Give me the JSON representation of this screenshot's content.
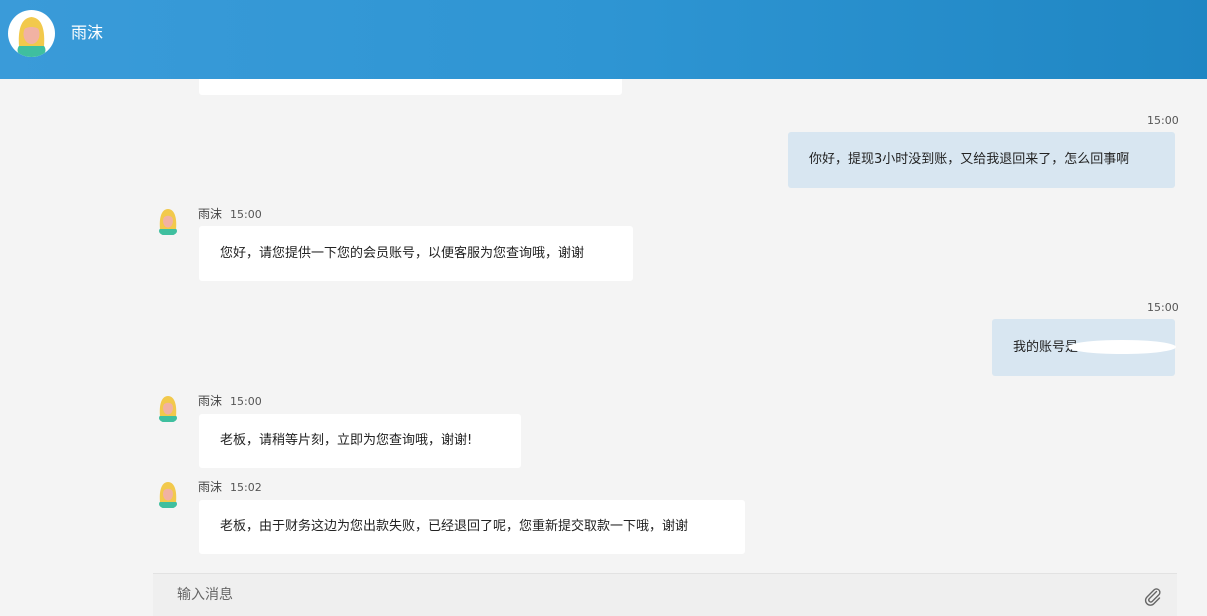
{
  "header": {
    "agent_name": "雨沫"
  },
  "messages": [
    {
      "time": "15:00",
      "text": "你好，提现3小时没到账，又给我退回来了，怎么回事啊"
    },
    {
      "sender": "雨沫",
      "time": "15:00",
      "text": "您好，请您提供一下您的会员账号，以便客服为您查询哦，谢谢"
    },
    {
      "time": "15:00",
      "text": "我的账号是"
    },
    {
      "sender": "雨沫",
      "time": "15:00",
      "text": "老板，请稍等片刻，立即为您查询哦，谢谢!"
    },
    {
      "sender": "雨沫",
      "time": "15:02",
      "text": "老板，由于财务这边为您出款失败，已经退回了呢，您重新提交取款一下哦，谢谢"
    }
  ],
  "composer": {
    "placeholder": "输入消息"
  },
  "colors": {
    "header": "#2e95d3",
    "outgoing_bubble": "#d8e6f1",
    "incoming_bubble": "#ffffff"
  }
}
